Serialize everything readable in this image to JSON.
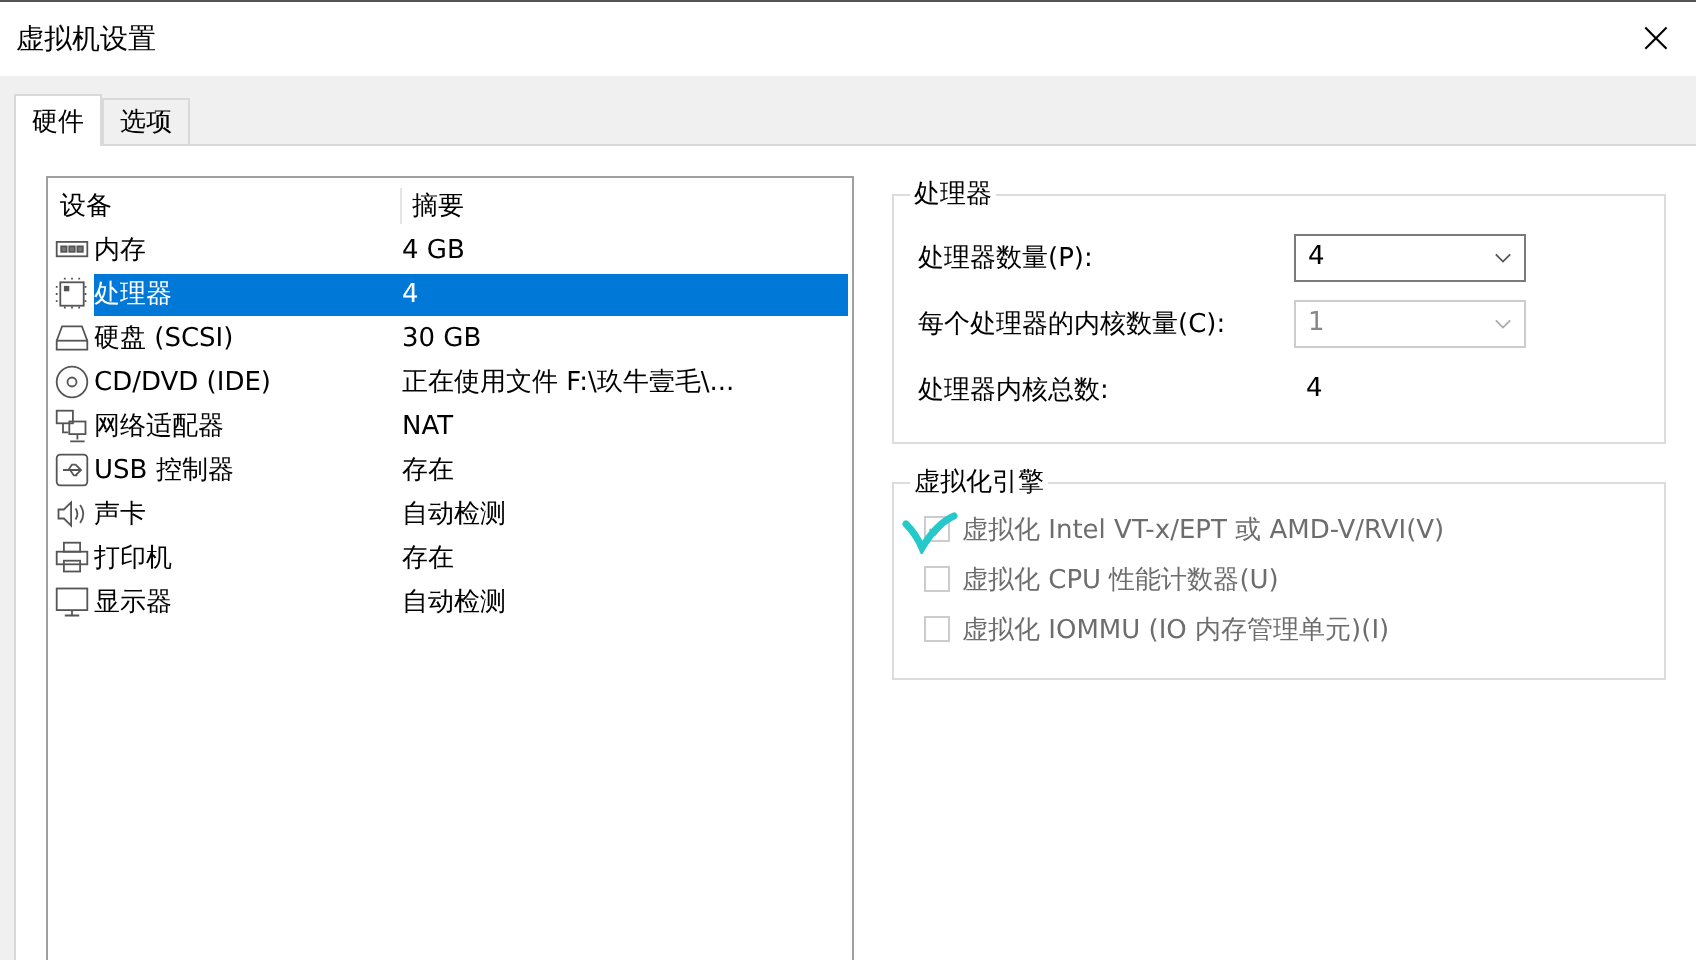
{
  "window": {
    "title": "虚拟机设置",
    "close": "×"
  },
  "tabs": [
    {
      "label": "硬件",
      "selected": true
    },
    {
      "label": "选项",
      "selected": false
    }
  ],
  "devices": {
    "columns": [
      "设备",
      "摘要"
    ],
    "rows": [
      {
        "kind": "memory",
        "name": "内存",
        "summary": "4 GB",
        "selected": false
      },
      {
        "kind": "cpu",
        "name": "处理器",
        "summary": "4",
        "selected": true
      },
      {
        "kind": "disk",
        "name": "硬盘 (SCSI)",
        "summary": "30 GB",
        "selected": false
      },
      {
        "kind": "cd",
        "name": "CD/DVD (IDE)",
        "summary": "正在使用文件 F:\\玖牛壹毛\\...",
        "selected": false
      },
      {
        "kind": "network",
        "name": "网络适配器",
        "summary": "NAT",
        "selected": false
      },
      {
        "kind": "usb",
        "name": "USB 控制器",
        "summary": "存在",
        "selected": false
      },
      {
        "kind": "sound",
        "name": "声卡",
        "summary": "自动检测",
        "selected": false
      },
      {
        "kind": "printer",
        "name": "打印机",
        "summary": "存在",
        "selected": false
      },
      {
        "kind": "display",
        "name": "显示器",
        "summary": "自动检测",
        "selected": false
      }
    ]
  },
  "processor": {
    "title": "处理器",
    "fields": [
      {
        "kind": "dropdown",
        "label": "处理器数量(P):",
        "value": "4",
        "disabled": false
      },
      {
        "kind": "dropdown",
        "label": "每个处理器的内核数量(C):",
        "value": "1",
        "disabled": true
      },
      {
        "kind": "readout",
        "label": "处理器内核总数:",
        "value": "4"
      }
    ]
  },
  "virtualization": {
    "title": "虚拟化引擎",
    "options": [
      {
        "label": "虚拟化 Intel VT-x/EPT 或 AMD-V/RVI(V)",
        "checked": true,
        "disabled": true
      },
      {
        "label": "虚拟化 CPU 性能计数器(U)",
        "checked": false,
        "disabled": true
      },
      {
        "label": "虚拟化 IOMMU (IO 内存管理单元)(I)",
        "checked": false,
        "disabled": true
      }
    ]
  }
}
